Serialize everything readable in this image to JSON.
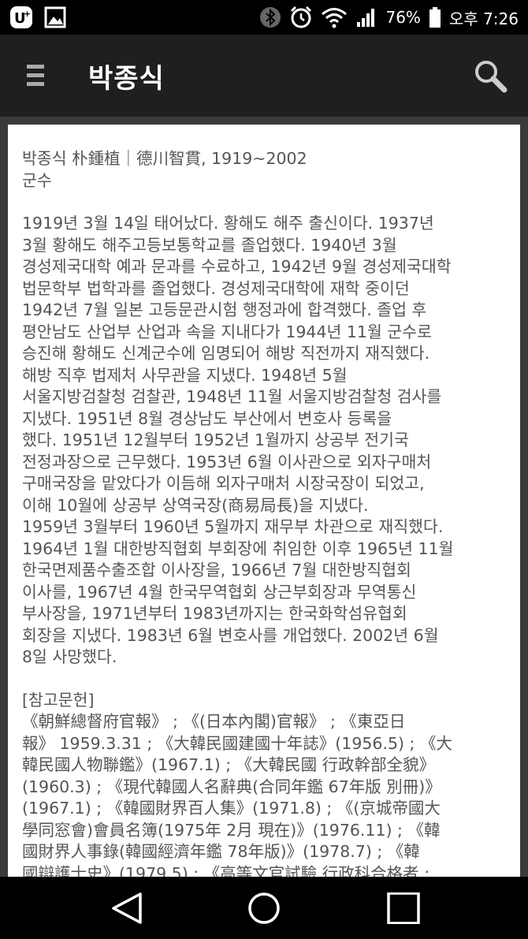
{
  "status_bar": {
    "carrier_icon": "uplus-icon",
    "gallery_icon": "image-icon",
    "battery": "76%",
    "time": "오후 7:26"
  },
  "app_bar": {
    "title": "박종식",
    "menu_icon": "hamburger-icon",
    "search_icon": "search-icon"
  },
  "article": {
    "header_line1": "박종식 朴鍾植｜德川智貫, 1919~2002",
    "header_line2": "군수",
    "body": "1919년 3월 14일 태어났다. 황해도 해주 출신이다. 1937년\n3월 황해도 해주고등보통학교를 졸업했다. 1940년 3월\n경성제국대학 예과 문과를 수료하고, 1942년 9월 경성제국대학\n법문학부 법학과를 졸업했다. 경성제국대학에 재학 중이던\n1942년 7월 일본 고등문관시험 행정과에 합격했다. 졸업 후\n평안남도 산업부 산업과 속을 지내다가 1944년 11월 군수로\n승진해 황해도 신계군수에 임명되어 해방 직전까지 재직했다.\n해방 직후 법제처 사무관을 지냈다. 1948년 5월\n서울지방검찰청 검찰관, 1948년 11월 서울지방검찰청 검사를\n지냈다. 1951년 8월 경상남도 부산에서 변호사 등록을\n했다. 1951년 12월부터 1952년 1월까지 상공부 전기국\n전정과장으로 근무했다. 1953년 6월 이사관으로 외자구매처\n구매국장을 맡았다가 이듬해 외자구매처 시장국장이 되었고,\n이해 10월에 상공부 상역국장(商易局長)을 지냈다.\n1959년 3월부터 1960년 5월까지 재무부 차관으로 재직했다.\n1964년 1월 대한방직협회 부회장에 취임한 이후 1965년 11월\n한국면제품수출조합 이사장을, 1966년 7월 대한방직협회\n이사를, 1967년 4월 한국무역협회 상근부회장과 무역통신\n부사장을, 1971년부터 1983년까지는 한국화학섬유협회\n회장을 지냈다. 1983년 6월 변호사를 개업했다. 2002년 6월\n8일 사망했다.",
    "references_heading": "[참고문헌]",
    "references": "《朝鮮總督府官報》 ; 《(日本內閣)官報》 ; 《東亞日\n報》 1959.3.31 ; 《大韓民國建國十年誌》(1956.5) ; 《大\n韓民國人物聯鑑》(1967.1) ; 《大韓民國 行政幹部全貌》\n(1960.3) ; 《現代韓國人名辭典(合同年鑑 67年版 別冊)》\n(1967.1) ; 《韓國財界百人集》(1971.8) ; 《(京城帝國大\n學同窓會)會員名簿(1975年 2月 現在)》(1976.11) ; 《韓\n國財界人事錄(韓國經濟年鑑 78年版)》(1978.7) ; 《韓\n國辯護士史》(1979.5) ; 《高等文官試驗 行政科合格者 :"
  },
  "nav_bar": {
    "back_icon": "back-triangle-icon",
    "home_icon": "home-circle-icon",
    "recents_icon": "recents-square-icon"
  }
}
